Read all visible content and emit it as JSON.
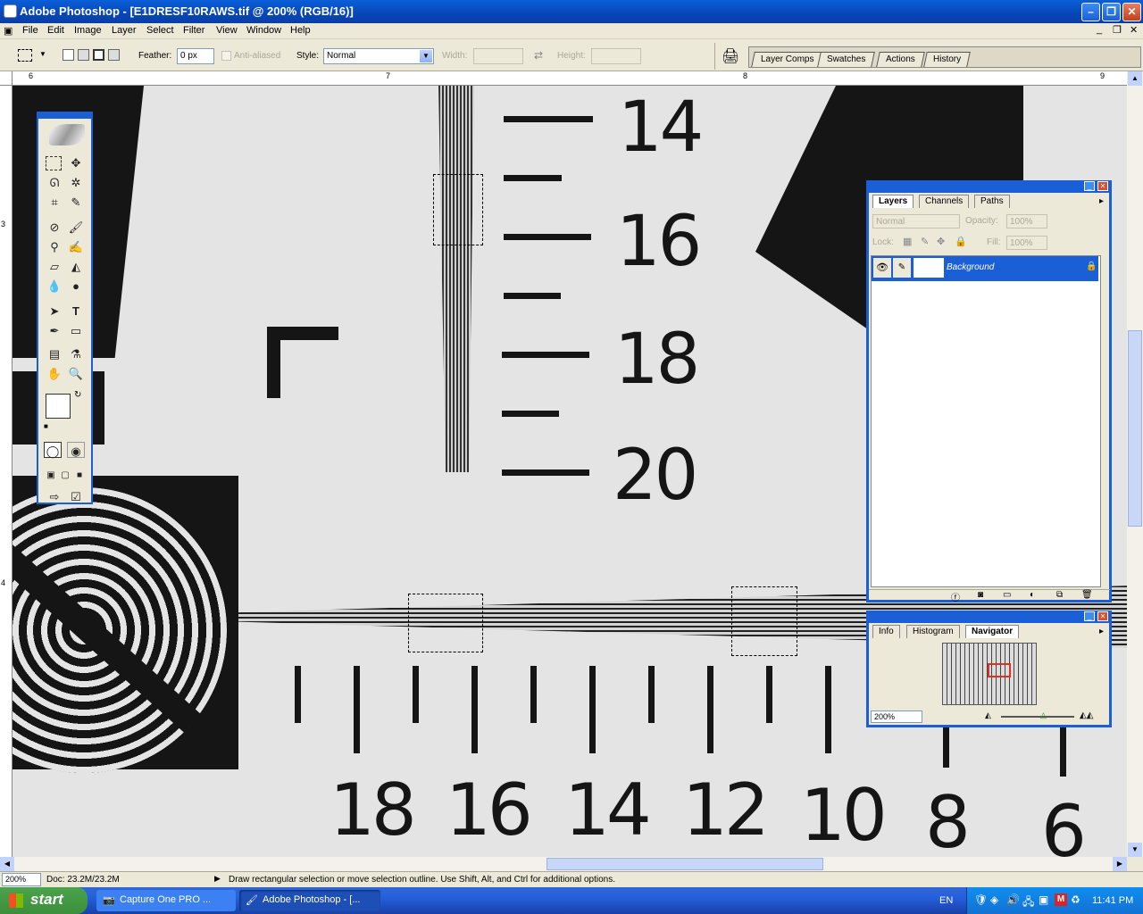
{
  "window": {
    "title": "Adobe Photoshop - [E1DRESF10RAWS.tif @ 200% (RGB/16)]"
  },
  "menu": [
    "File",
    "Edit",
    "Image",
    "Layer",
    "Select",
    "Filter",
    "View",
    "Window",
    "Help"
  ],
  "options": {
    "feather_label": "Feather:",
    "feather_value": "0 px",
    "antialiased_label": "Anti-aliased",
    "style_label": "Style:",
    "style_value": "Normal",
    "width_label": "Width:",
    "height_label": "Height:"
  },
  "palette_well": [
    "Layer Comps",
    "Swatches",
    "Actions",
    "History"
  ],
  "rulers": {
    "h": [
      "6",
      "7",
      "8",
      "9"
    ],
    "v": [
      "3",
      "4"
    ]
  },
  "chart_labels": {
    "vertical": [
      "14",
      "16",
      "18",
      "20"
    ],
    "horizontal": [
      "18",
      "16",
      "14",
      "12",
      "10",
      "8",
      "6"
    ]
  },
  "layers_panel": {
    "tabs": [
      "Layers",
      "Channels",
      "Paths"
    ],
    "blend_mode": "Normal",
    "opacity_label": "Opacity:",
    "opacity_value": "100%",
    "lock_label": "Lock:",
    "fill_label": "Fill:",
    "fill_value": "100%",
    "layer_name": "Background"
  },
  "navigator_panel": {
    "tabs": [
      "Info",
      "Histogram",
      "Navigator"
    ],
    "zoom": "200%"
  },
  "status": {
    "zoom": "200%",
    "doc": "Doc: 23.2M/23.2M",
    "hint": "Draw rectangular selection or move selection outline.  Use Shift, Alt, and Ctrl for additional options."
  },
  "taskbar": {
    "start": "start",
    "buttons": [
      "Capture One PRO ...",
      "Adobe Photoshop - [..."
    ],
    "lang": "EN",
    "clock": "11:41 PM"
  },
  "colors": {
    "title_blue": "#0a5fd8",
    "task_green": "#3c8f3c",
    "selection_blue": "#1a5fd6"
  }
}
